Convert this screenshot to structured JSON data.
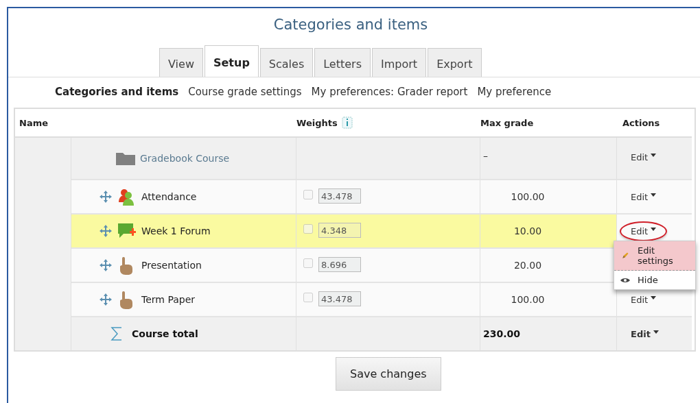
{
  "title": "Categories and items",
  "tabs": [
    {
      "label": "View",
      "selected": false
    },
    {
      "label": "Setup",
      "selected": true
    },
    {
      "label": "Scales",
      "selected": false
    },
    {
      "label": "Letters",
      "selected": false
    },
    {
      "label": "Import",
      "selected": false
    },
    {
      "label": "Export",
      "selected": false
    }
  ],
  "subnav": [
    {
      "label": "Categories and items",
      "selected": true
    },
    {
      "label": "Course grade settings",
      "selected": false
    },
    {
      "label": "My preferences: Grader report",
      "selected": false
    },
    {
      "label": "My preference",
      "selected": false
    }
  ],
  "table": {
    "columns": [
      "Name",
      "Weights",
      "Max grade",
      "Actions"
    ],
    "rows": [
      {
        "kind": "category",
        "name": "Gradebook Course",
        "max_grade": "–",
        "action": "Edit",
        "highlighted": false,
        "circled": false
      },
      {
        "kind": "attendance",
        "name": "Attendance",
        "weight": "43.478",
        "weight_checked": false,
        "max_grade": "100.00",
        "action": "Edit",
        "highlighted": false,
        "circled": false
      },
      {
        "kind": "forum",
        "name": "Week 1 Forum",
        "weight": "4.348",
        "weight_checked": false,
        "max_grade": "10.00",
        "action": "Edit",
        "highlighted": true,
        "circled": true
      },
      {
        "kind": "assignment",
        "name": "Presentation",
        "weight": "8.696",
        "weight_checked": false,
        "max_grade": "20.00",
        "highlighted": false
      },
      {
        "kind": "assignment",
        "name": "Term Paper",
        "weight": "43.478",
        "weight_checked": false,
        "max_grade": "100.00",
        "action": "Edit",
        "highlighted": false,
        "circled": false
      },
      {
        "kind": "total",
        "name": "Course total",
        "max_grade": "230.00",
        "action": "Edit",
        "highlighted": false,
        "circled": false
      }
    ]
  },
  "menu": [
    {
      "kind": "edit",
      "label": "Edit settings",
      "selected": true
    },
    {
      "kind": "hide",
      "label": "Hide",
      "selected": false
    }
  ],
  "save_button": "Save changes"
}
